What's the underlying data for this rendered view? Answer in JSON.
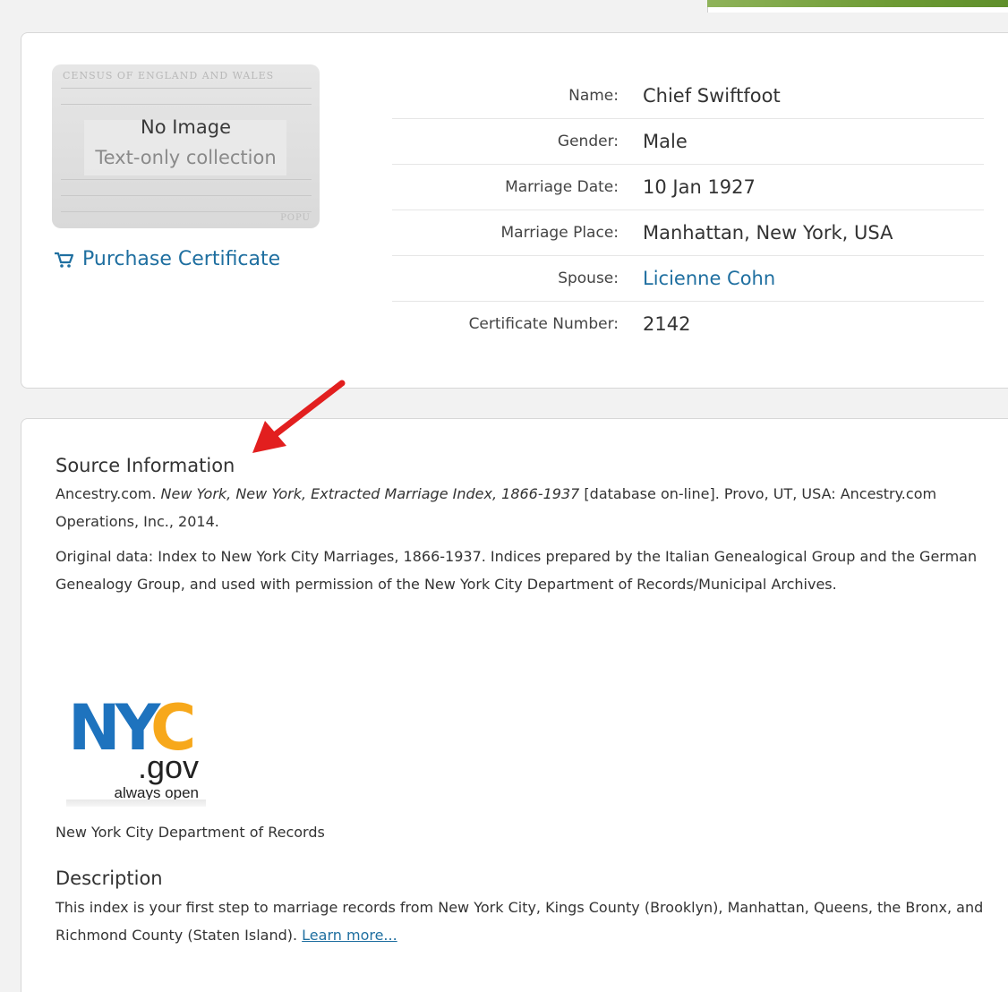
{
  "record": {
    "image": {
      "no_image": "No Image",
      "text_only": "Text-only collection",
      "doc_title": "CENSUS OF ENGLAND AND WALES",
      "doc_word": "POPU"
    },
    "purchase_label": "Purchase Certificate",
    "facts": [
      {
        "label": "Name:",
        "value": "Chief Swiftfoot"
      },
      {
        "label": "Gender:",
        "value": "Male"
      },
      {
        "label": "Marriage Date:",
        "value": "10 Jan 1927"
      },
      {
        "label": "Marriage Place:",
        "value": "Manhattan, New York, USA"
      },
      {
        "label": "Spouse:",
        "value": "Licienne Cohn"
      },
      {
        "label": "Certificate Number:",
        "value": "2142"
      }
    ]
  },
  "source": {
    "heading": "Source Information",
    "citation_pre": "Ancestry.com. ",
    "citation_title": "New York, New York, Extracted Marriage Index, 1866-1937",
    "citation_post": " [database on-line]. Provo, UT, USA: Ancestry.com Operations, Inc., 2014.",
    "original_data": "Original data: Index to New York City Marriages, 1866-1937. Indices prepared by the Italian Genealogical Group and the German Genealogy Group, and used with permission of the New York City Department of Records/Municipal Archives.",
    "logo": {
      "nyc": "NYC",
      "gov": ".gov",
      "tagline": "always open"
    },
    "logo_caption": "New York City Department of Records",
    "description_heading": "Description",
    "description_text": "This index is your first step to marriage records from New York City, Kings County (Brooklyn), Manhattan, Queens, the Bronx, and Richmond County (Staten Island). ",
    "learn_more": "Learn more..."
  },
  "colors": {
    "link": "#1f6fa0",
    "arrow": "#e21f1f",
    "nyc_blue": "#1e73be",
    "nyc_orange": "#f7a81b",
    "accent_green": "#6e9b35"
  }
}
